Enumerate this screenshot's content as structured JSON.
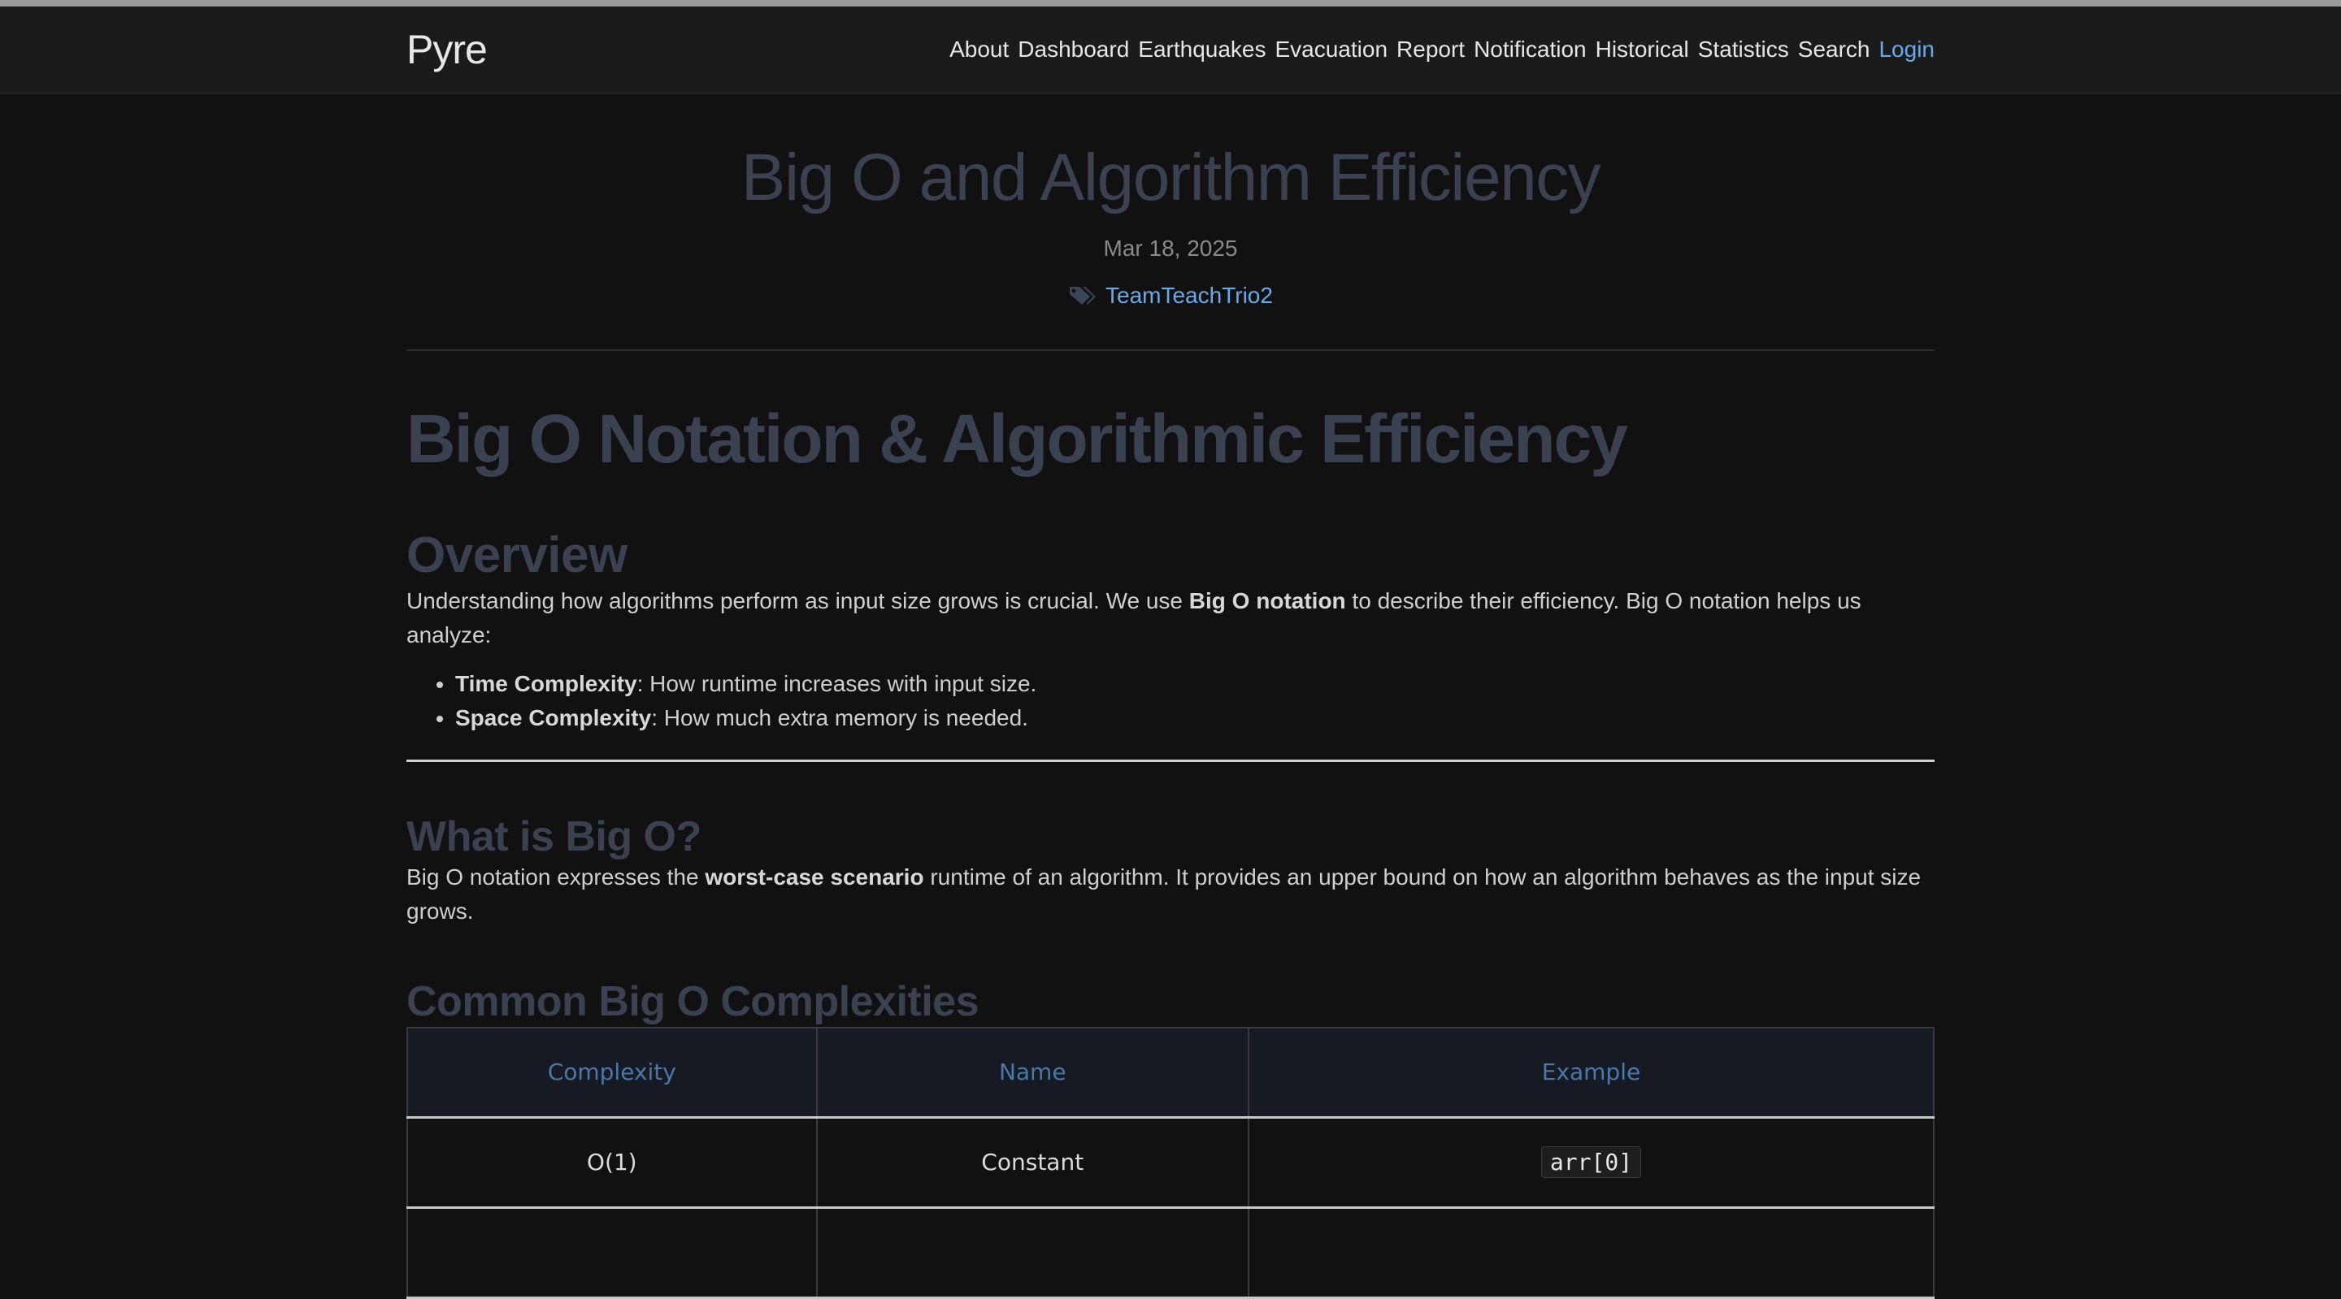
{
  "nav": {
    "brand": "Pyre",
    "links": [
      "About",
      "Dashboard",
      "Earthquakes",
      "Evacuation",
      "Report",
      "Notification",
      "Historical",
      "Statistics",
      "Search"
    ],
    "login": "Login",
    "login_color": "#6aaae8"
  },
  "post": {
    "title": "Big O and Algorithm Efficiency",
    "date": "Mar 18, 2025",
    "tag_icon": "tags-icon",
    "tag": "TeamTeachTrio2"
  },
  "article": {
    "h1": "Big O Notation & Algorithmic Efficiency",
    "overview": {
      "heading": "Overview",
      "p_before": "Understanding how algorithms perform as input size grows is crucial. We use ",
      "p_bold": "Big O notation",
      "p_after": " to describe their efficiency. Big O notation helps us analyze:",
      "bullets": [
        {
          "bold": "Time Complexity",
          "text": ": How runtime increases with input size."
        },
        {
          "bold": "Space Complexity",
          "text": ": How much extra memory is needed."
        }
      ]
    },
    "what_is": {
      "heading": "What is Big O?",
      "p_before": "Big O notation expresses the ",
      "p_bold": "worst-case scenario",
      "p_after": " runtime of an algorithm. It provides an upper bound on how an algorithm behaves as the input size grows."
    },
    "common": {
      "heading": "Common Big O Complexities",
      "columns": [
        "Complexity",
        "Name",
        "Example"
      ],
      "rows": [
        {
          "complexity": "O(1)",
          "name": "Constant",
          "example": "arr[0]"
        }
      ]
    }
  }
}
